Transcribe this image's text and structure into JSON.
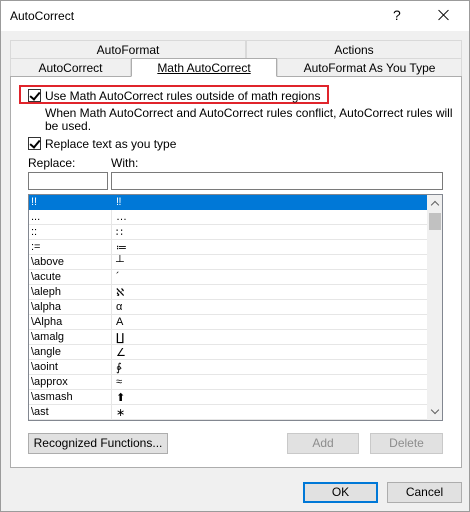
{
  "window": {
    "title": "AutoCorrect",
    "help_glyph": "?"
  },
  "tabs": {
    "row1": [
      {
        "label": "AutoFormat"
      },
      {
        "label": "Actions"
      }
    ],
    "row2": [
      {
        "label": "AutoCorrect"
      },
      {
        "label": "Math AutoCorrect",
        "active": true
      },
      {
        "label": "AutoFormat As You Type"
      }
    ]
  },
  "options": {
    "use_math_outside": {
      "label": "Use Math AutoCorrect rules outside of math regions",
      "checked": true
    },
    "conflict_note": "When Math AutoCorrect and AutoCorrect rules conflict, AutoCorrect rules will be used.",
    "replace_as_you_type": {
      "label": "Replace text as you type",
      "checked": true
    }
  },
  "fields": {
    "replace_label": "Replace:",
    "with_label": "With:",
    "replace_value": "",
    "with_value": ""
  },
  "list": {
    "rows": [
      {
        "replace": "!!",
        "with": "‼",
        "selected": true
      },
      {
        "replace": "...",
        "with": "…"
      },
      {
        "replace": "::",
        "with": "∷"
      },
      {
        "replace": ":=",
        "with": "≔"
      },
      {
        "replace": "\\above",
        "with": "┴"
      },
      {
        "replace": "\\acute",
        "with": "´"
      },
      {
        "replace": "\\aleph",
        "with": "ℵ"
      },
      {
        "replace": "\\alpha",
        "with": "α"
      },
      {
        "replace": "\\Alpha",
        "with": "Α"
      },
      {
        "replace": "\\amalg",
        "with": "∐"
      },
      {
        "replace": "\\angle",
        "with": "∠"
      },
      {
        "replace": "\\aoint",
        "with": "∳"
      },
      {
        "replace": "\\approx",
        "with": "≈"
      },
      {
        "replace": "\\asmash",
        "with": "⬆"
      },
      {
        "replace": "\\ast",
        "with": "∗"
      }
    ]
  },
  "buttons": {
    "recognized_functions": "Recognized Functions...",
    "add": "Add",
    "delete": "Delete",
    "ok": "OK",
    "cancel": "Cancel"
  }
}
